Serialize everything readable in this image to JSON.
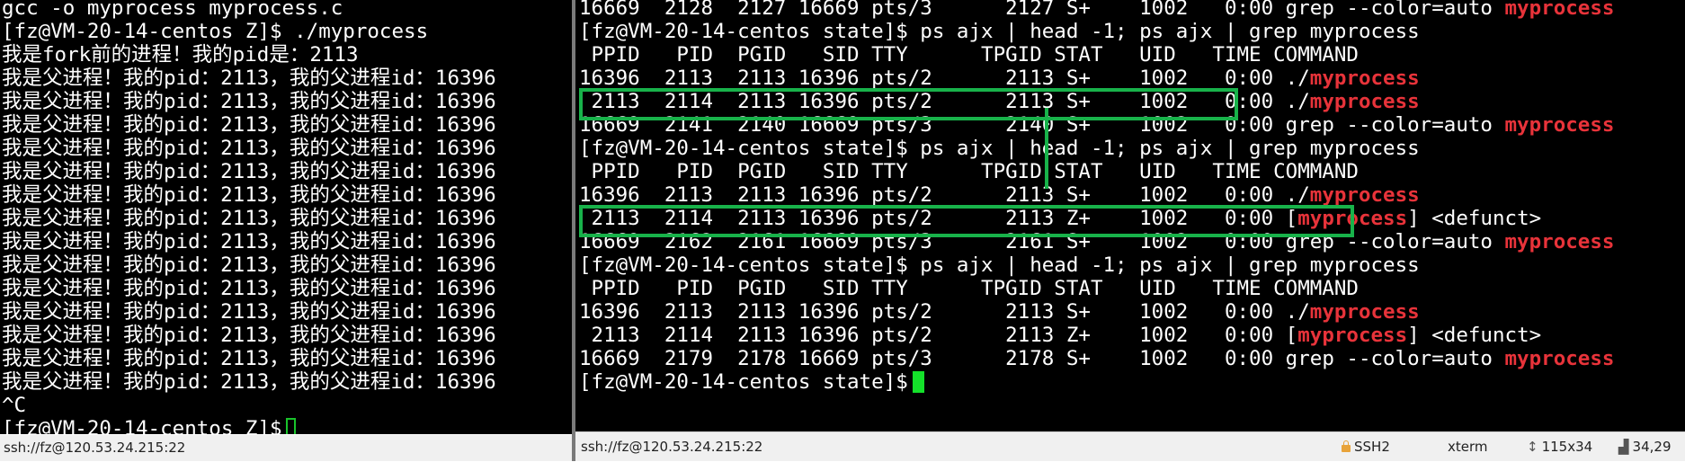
{
  "left_terminal": {
    "lines": [
      "gcc -o myprocess myprocess.c",
      "[fz@VM-20-14-centos Z]$ ./myprocess",
      "我是fork前的进程！我的pid是：2113",
      "我是父进程！我的pid：2113，我的父进程id：16396",
      "我是父进程！我的pid：2113，我的父进程id：16396",
      "我是父进程！我的pid：2113，我的父进程id：16396",
      "我是父进程！我的pid：2113，我的父进程id：16396",
      "我是父进程！我的pid：2113，我的父进程id：16396",
      "我是父进程！我的pid：2113，我的父进程id：16396",
      "我是父进程！我的pid：2113，我的父进程id：16396",
      "我是父进程！我的pid：2113，我的父进程id：16396",
      "我是父进程！我的pid：2113，我的父进程id：16396",
      "我是父进程！我的pid：2113，我的父进程id：16396",
      "我是父进程！我的pid：2113，我的父进程id：16396",
      "我是父进程！我的pid：2113，我的父进程id：16396",
      "我是父进程！我的pid：2113，我的父进程id：16396",
      "我是父进程！我的pid：2113，我的父进程id：16396",
      "^C",
      "[fz@VM-20-14-centos Z]$ "
    ]
  },
  "right_terminal": {
    "lines": [
      [
        "16669  2128  2127 16669 pts/3      2127 S+    1002   0:00 grep --color=auto ",
        {
          "h": "myprocess"
        }
      ],
      [
        "[fz@VM-20-14-centos state]$ ps ajx | head -1; ps ajx | grep myprocess"
      ],
      [
        " PPID   PID  PGID   SID TTY      TPGID STAT   UID   TIME COMMAND"
      ],
      [
        "16396  2113  2113 16396 pts/2      2113 S+    1002   0:00 ./",
        {
          "h": "myprocess"
        }
      ],
      [
        " 2113  2114  2113 16396 pts/2      2113 S+    1002   0:00 ./",
        {
          "h": "myprocess"
        }
      ],
      [
        "16669  2141  2140 16669 pts/3      2140 S+    1002   0:00 grep --color=auto ",
        {
          "h": "myprocess"
        }
      ],
      [
        "[fz@VM-20-14-centos state]$ ps ajx | head -1; ps ajx | grep myprocess"
      ],
      [
        " PPID   PID  PGID   SID TTY      TPGID STAT   UID   TIME COMMAND"
      ],
      [
        "16396  2113  2113 16396 pts/2      2113 S+    1002   0:00 ./",
        {
          "h": "myprocess"
        }
      ],
      [
        " 2113  2114  2113 16396 pts/2      2113 Z+    1002   0:00 [",
        {
          "h": "myprocess"
        },
        "] <defunct>"
      ],
      [
        "16669  2162  2161 16669 pts/3      2161 S+    1002   0:00 grep --color=auto ",
        {
          "h": "myprocess"
        }
      ],
      [
        "[fz@VM-20-14-centos state]$ ps ajx | head -1; ps ajx | grep myprocess"
      ],
      [
        " PPID   PID  PGID   SID TTY      TPGID STAT   UID   TIME COMMAND"
      ],
      [
        "16396  2113  2113 16396 pts/2      2113 S+    1002   0:00 ./",
        {
          "h": "myprocess"
        }
      ],
      [
        " 2113  2114  2113 16396 pts/2      2113 Z+    1002   0:00 [",
        {
          "h": "myprocess"
        },
        "] <defunct>"
      ],
      [
        "16669  2179  2178 16669 pts/3      2178 S+    1002   0:00 grep --color=auto ",
        {
          "h": "myprocess"
        }
      ],
      [
        "[fz@VM-20-14-centos state]$ "
      ]
    ]
  },
  "left_status": {
    "connection": "ssh://fz@120.53.24.215:22"
  },
  "right_status": {
    "connection": "ssh://fz@120.53.24.215:22",
    "protocol": "SSH2",
    "terminal_type": "xterm",
    "size": "115x34",
    "cursor_pos": "34,29"
  },
  "colors": {
    "highlight": "#e8333a",
    "annotation_box": "#18b24a",
    "cursor": "#14e12a"
  }
}
